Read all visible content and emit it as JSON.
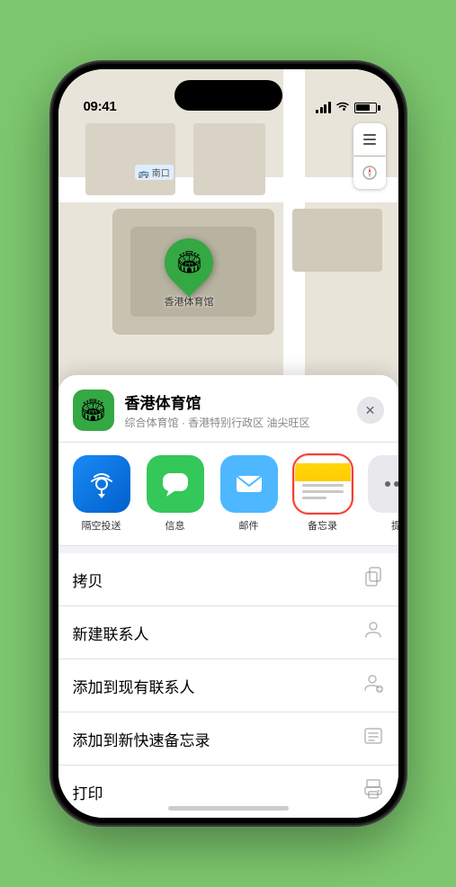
{
  "status_bar": {
    "time": "09:41",
    "navigation_icon": "▶"
  },
  "map": {
    "label_text": "🚌 南口"
  },
  "map_controls": {
    "layers_icon": "🗺",
    "compass_icon": "⬆"
  },
  "pin": {
    "label": "香港体育馆",
    "icon": "🏟"
  },
  "location_header": {
    "name": "香港体育馆",
    "subtitle": "综合体育馆 · 香港特别行政区 油尖旺区",
    "icon": "🏟",
    "close": "✕"
  },
  "share_items": [
    {
      "id": "airdrop",
      "label": "隔空投送",
      "icon": "📡"
    },
    {
      "id": "messages",
      "label": "信息",
      "icon": "💬"
    },
    {
      "id": "mail",
      "label": "邮件",
      "icon": "✉"
    },
    {
      "id": "notes",
      "label": "备忘录",
      "icon": ""
    },
    {
      "id": "more",
      "label": "提",
      "icon": "..."
    }
  ],
  "action_rows": [
    {
      "label": "拷贝",
      "icon": "⎘"
    },
    {
      "label": "新建联系人",
      "icon": "👤"
    },
    {
      "label": "添加到现有联系人",
      "icon": "👤"
    },
    {
      "label": "添加到新快速备忘录",
      "icon": "⬜"
    },
    {
      "label": "打印",
      "icon": "🖨"
    }
  ]
}
